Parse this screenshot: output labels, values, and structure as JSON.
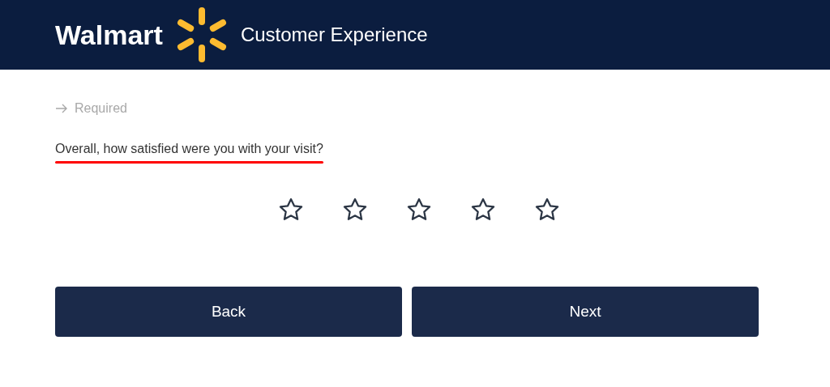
{
  "header": {
    "brand": "Walmart",
    "title": "Customer Experience"
  },
  "required_note": "Required",
  "question": {
    "text": "Overall, how satisfied were you with your visit?",
    "underlined": true
  },
  "rating": {
    "stars": 0
  },
  "buttons": [
    "Back",
    "Next"
  ]
}
